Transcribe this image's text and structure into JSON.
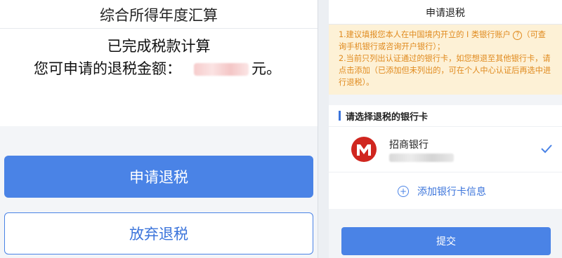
{
  "left": {
    "title": "综合所得年度汇算",
    "result_line1": "已完成税款计算",
    "result_line2_prefix": "您可申请的退税金额：",
    "result_line2_suffix": "元。",
    "apply_button": "申请退税",
    "abandon_button": "放弃退税"
  },
  "right": {
    "title": "申请退税",
    "notice": {
      "line1_a": "1.建议填报您本人在中国境内开立的 I 类银行账户",
      "line1_b": "（可查询手机银行或咨询开户银行）；",
      "line2": "2.当前只列出认证通过的银行卡，如您想退至其他银行卡，请点击添加（已添加但未列出的，可在个人中心认证后再选中进行退税）。"
    },
    "section_title": "请选择退税的银行卡",
    "bank": {
      "name": "招商银行"
    },
    "add_label": "添加银行卡信息",
    "submit_label": "提交"
  },
  "icons": {
    "question": "question-circle-icon",
    "check": "check-icon",
    "add": "plus-circle-icon",
    "bank_logo": "cmb-logo-icon"
  },
  "colors": {
    "primary": "#4a83e6",
    "notice_text": "#e08a1e",
    "notice_bg": "#fdf1d6",
    "cmb_red": "#d0261f"
  }
}
